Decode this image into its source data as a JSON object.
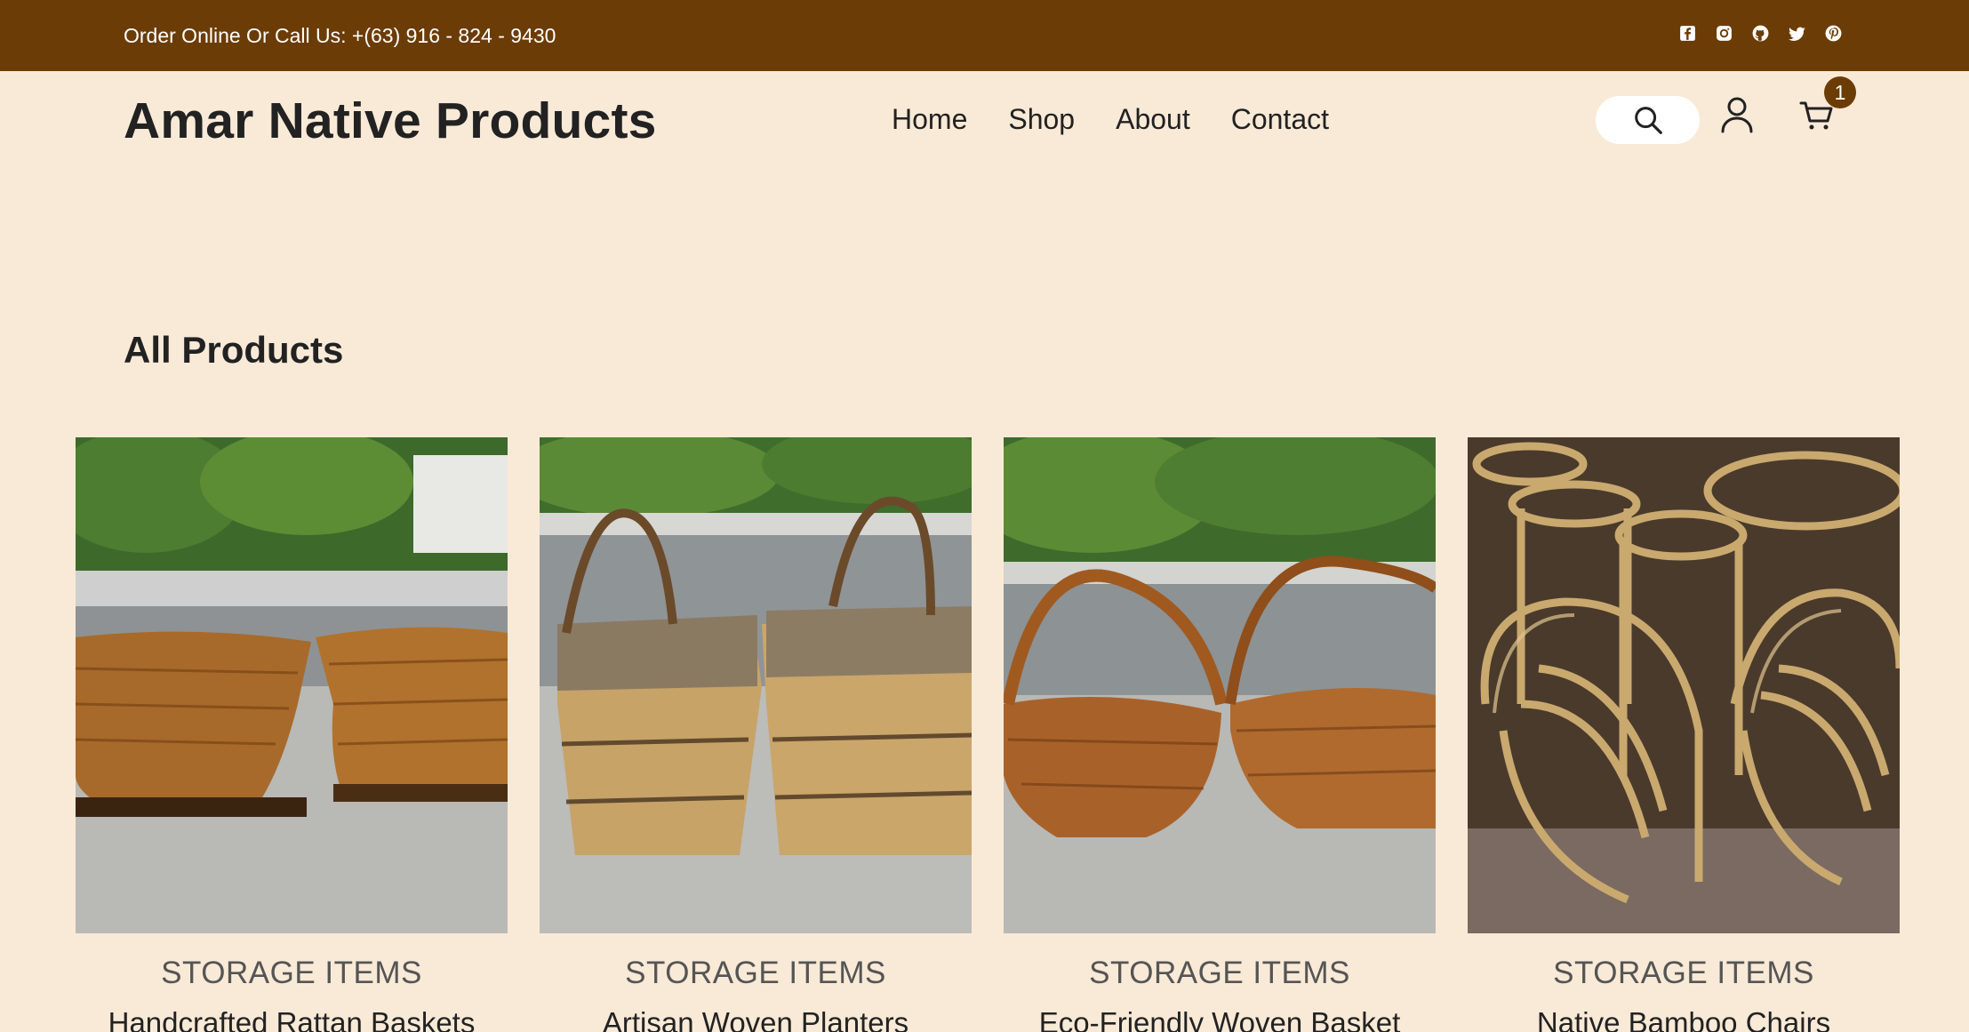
{
  "topbar": {
    "contact_text": "Order Online Or Call Us: +(63) 916 - 824 - 9430",
    "socials": [
      "facebook-icon",
      "instagram-icon",
      "github-icon",
      "twitter-icon",
      "pinterest-icon"
    ]
  },
  "header": {
    "logo": "Amar Native Products",
    "nav": [
      "Home",
      "Shop",
      "About",
      "Contact"
    ],
    "cart_count": "1"
  },
  "main": {
    "section_title": "All Products",
    "products": [
      {
        "category": "STORAGE ITEMS",
        "name": "Handcrafted Rattan Baskets"
      },
      {
        "category": "STORAGE ITEMS",
        "name": "Artisan Woven Planters"
      },
      {
        "category": "STORAGE ITEMS",
        "name": "Eco-Friendly Woven Basket"
      },
      {
        "category": "STORAGE ITEMS",
        "name": "Native Bamboo Chairs"
      }
    ]
  },
  "colors": {
    "topbar_bg": "#6b3c05",
    "page_bg": "#f9ead7",
    "badge_bg": "#6b3c05"
  }
}
